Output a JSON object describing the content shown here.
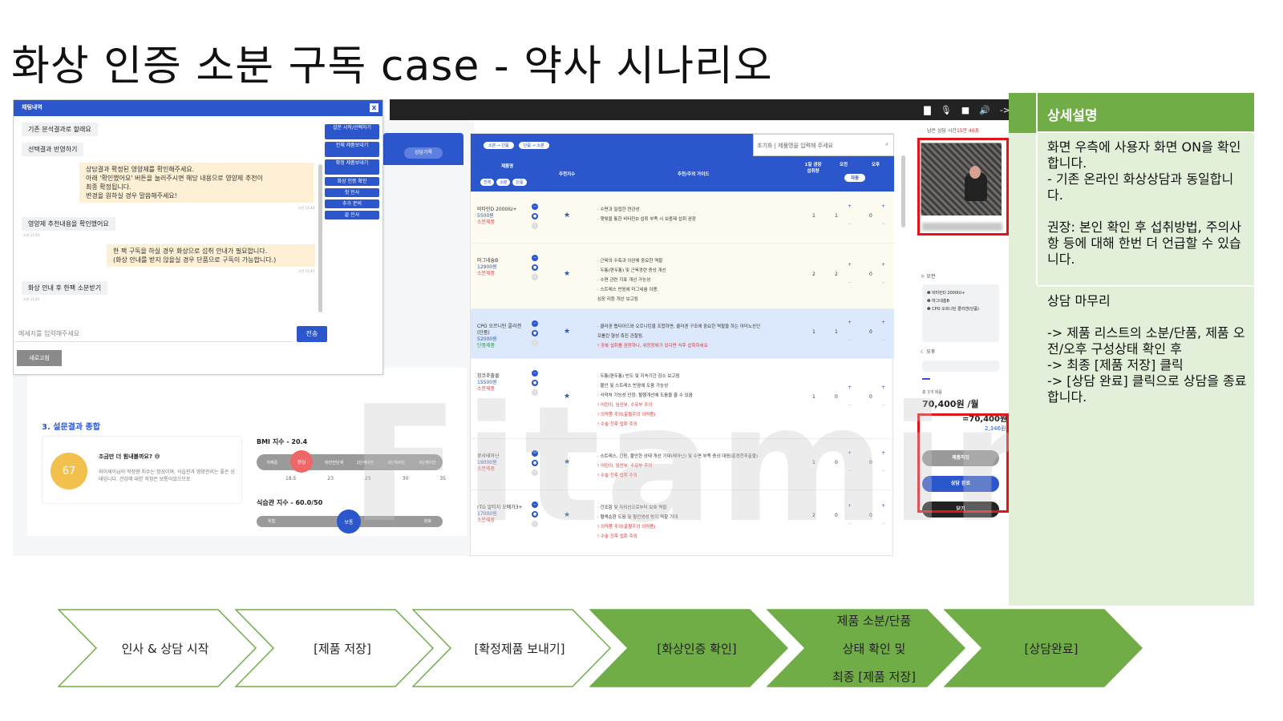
{
  "slide": {
    "title": "화상 인증 소분 구독 case - 약사 시나리오"
  },
  "topbar": {
    "icons": [
      "chat-icon",
      "mic-icon",
      "camera-icon",
      "speaker-icon",
      "arrow-icon"
    ],
    "arrow_label": "->"
  },
  "chat": {
    "header": "채팅내역",
    "close": "x",
    "messages": [
      {
        "from": "user",
        "text": "기존 분석결과로 할래요",
        "time": ""
      },
      {
        "from": "user",
        "text": "선택결과 반영하기",
        "time": ""
      },
      {
        "from": "bot",
        "text": "상담결과 확정된 영양제를 확인해주세요.\n아래 '확인했어요' 버튼을 눌러주시면 해당 내용으로 영양제 추천이\n최종 확정됩니다.\n변경을 원하실 경우 말씀해주세요!",
        "time": "오전 11:44"
      },
      {
        "from": "user",
        "text": "영양제 추천내용을 확인했어요",
        "time": "오전 11:44"
      },
      {
        "from": "bot",
        "text": "한 팩 구독을 하실 경우 화상으로 섭취 안내가 필요합니다.\n(화상 안내를 받지 않을실 경우 단품으로 구독이 가능합니다.)",
        "time": "오전 11:45"
      },
      {
        "from": "user",
        "text": "화상 안내 후 한팩 소분받기",
        "time": "오전 11:45"
      }
    ],
    "quick_buttons": [
      "설문 시작/선택하기",
      "전체 제품보내기",
      "확정 제품보내기",
      "화상 인증 확인",
      "첫 인사",
      "추가 문의",
      "끝 인사"
    ],
    "input_placeholder": "메세지를 입력해주세요",
    "send": "전송",
    "refresh": "새로고침"
  },
  "left": {
    "consult_record": "상담기록",
    "section_title": "3. 설문결과 종합",
    "score": "67",
    "score_title": "조금만 더 힘내볼까요? 😅",
    "score_sub": "와이세이님의 적정량 지수는 정상이며, 식습관과 영양관리는 좋은 상태입니다. 건강에 대한 걱정은 보통이었으므로",
    "bmi_label": "BMI 지수 - 20.4",
    "bmi_segments": [
      "저체중",
      "정상",
      "비만전단계",
      "1단계비만",
      "2단계비만",
      "3단계비만"
    ],
    "bmi_ticks": [
      "18.5",
      "23",
      "25",
      "30",
      "35"
    ],
    "diet_label": "식습관 지수 - 60.0/50",
    "diet_left": "위험",
    "diet_mid": "보통",
    "diet_right": "양호"
  },
  "table": {
    "tags": [
      "소분 → 단품",
      "단품 → 소분"
    ],
    "search_reset": "초기화",
    "search_placeholder": "제품명을 입력해 주세요",
    "columns": [
      "제품명",
      "추천지수",
      "추천/주의 가이드",
      "1일 권장 섭취량",
      "오전",
      "오후"
    ],
    "filter_chips": [
      "전체",
      "소분",
      "단품"
    ],
    "auto_chip": "자동",
    "rows": [
      {
        "name": "비타민D 2000IU+",
        "price": "5500원",
        "type": "소분제품",
        "guide": [
          "· 수면과 밀접한 연관성",
          "· 햇빛을 통한 비타민D 섭취 부족 시 보충제 섭취 권장"
        ],
        "warn": [],
        "dose": "1",
        "am": "1",
        "pm": "0",
        "style": "yellow"
      },
      {
        "name": "마그네슘B",
        "price": "12900원",
        "type": "소분제품",
        "guide": [
          "· 근육의 수축과 이완에 중요한 역할",
          "· 두통(편두통) 및 근육경련 증상 개선",
          "· 수면 관련 지표 개선 가능성",
          "· 스트레스 반응에 마그네슘 이용",
          "  심장 리듬 개선 보고됨"
        ],
        "warn": [],
        "dose": "2",
        "am": "2",
        "pm": "0",
        "style": "yellow"
      },
      {
        "name": "CPO 오르니틴 콜라겐(단품)",
        "price": "52000원",
        "type": "단품제품",
        "guide": [
          "· 콜라겐 펩타이드와 오르니틴을 조합하면, 콜라겐 구조에 중요한 역할을 하는 아미노산인",
          "  프롤린 형성 촉진 관찰됨."
        ],
        "warn": [
          "! 공복 섭취를 권장하나, 위장장애가 있다면 식후 섭취하세요"
        ],
        "dose": "1",
        "am": "1",
        "pm": "0",
        "style": "blue"
      },
      {
        "name": "징코추출물",
        "price": "15500원",
        "type": "소분제품",
        "guide": [
          "· 두통(편두통) 빈도 및 지속기간 감소 보고됨",
          "· 불안 및 스트레스 반응에 도움 가능성",
          "· 식약처 기능성 인정: 혈행개선에 도움을 줄 수 있음"
        ],
        "warn": [
          "! 어린이, 임산부, 수유부 주의",
          "! 의약품 주의(출혈주의 의약품)",
          "! 수술 전후 섭취 주의"
        ],
        "dose": "1",
        "am": "0",
        "pm": "0",
        "style": "white"
      },
      {
        "name": "로사테아닌",
        "price": "19000원",
        "type": "소분제품",
        "guide": [
          "· 스트레스, 긴장, 불안한 상태 개선 기대(테아닌) 및 수면 부족 증상 대응(홍경천추출물)"
        ],
        "warn": [
          "! 어린이, 임산부, 수유부 주의",
          "! 수술 전후 섭취 주의"
        ],
        "dose": "1",
        "am": "0",
        "pm": "0",
        "style": "white"
      },
      {
        "name": "rTG 알티지 오메가3+",
        "price": "17000원",
        "type": "소분제품",
        "guide": [
          "· 건조함 및 자외선으로부터 보호 역할",
          "· 혈액순환 도움 및 혈전생성 방지 역할 기대"
        ],
        "warn": [
          "! 의약품 주의(출혈주의 의약품)",
          "! 수술 전후 섭취 주의"
        ],
        "dose": "2",
        "am": "0",
        "pm": "0",
        "style": "white"
      }
    ]
  },
  "right_panel": {
    "timer_label": "남은 상담 시간",
    "timer_value": "15분 46초",
    "morning": "오전",
    "morning_items": [
      "비타민D 2000IU+",
      "마그네슘B",
      "CPO 오르니틴 콜라겐(단품)"
    ],
    "evening": "오후",
    "sum_label": "총 3개 제품",
    "sum_main": "70,400원 /월",
    "sum_eq": "=70,400원 /월",
    "sum_daily": "2,346원 /일",
    "btn_save": "제품저장",
    "btn_complete": "상담 완료",
    "btn_close": "닫기"
  },
  "watermark": "Fitamin",
  "description": {
    "header": "상세설명",
    "block1": "화면 우측에 사용자 화면 ON을 확인합니다.\n- 기존 온라인 화상상담과 동일합니다.\n\n권장: 본인 확인 후 섭취방법, 주의사항 등에 대해 한번 더 언급할 수 있습니다.",
    "block2": "상담 마무리\n\n-> 제품 리스트의 소분/단품, 제품 오전/오후 구성상태 확인 후\n-> 최종 [제품 저장] 클릭\n-> [상담 완료] 클릭으로 상담을 종료합니다."
  },
  "flow": {
    "steps": [
      {
        "label": "인사 & 상담 시작",
        "active": false
      },
      {
        "label": "[제품 저장]",
        "active": false
      },
      {
        "label": "[확정제품 보내기]",
        "active": false
      },
      {
        "label": "[화상인증 확인]",
        "active": true
      },
      {
        "label": "제품 소분/단품\n상태 확인 및\n최종 [제품 저장]",
        "active": true
      },
      {
        "label": "[상담완료]",
        "active": true
      }
    ],
    "colors": {
      "active": "#70ad47",
      "inactive": "#ffffff",
      "border": "#70ad47"
    }
  }
}
